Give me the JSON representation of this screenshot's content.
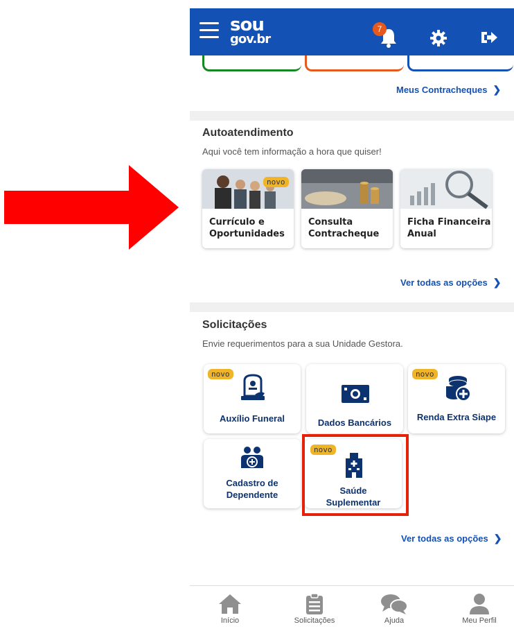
{
  "header": {
    "logo_top": "sou",
    "logo_bottom": "gov.br",
    "notification_count": "7"
  },
  "payslip_link": "Meus Contracheques",
  "autoatendimento": {
    "title": "Autoatendimento",
    "subtitle": "Aqui você tem informação a hora que quiser!",
    "cards": [
      {
        "line1": "Currículo e",
        "line2": "Oportunidades",
        "badge": "novo"
      },
      {
        "line1": "Consulta",
        "line2": "Contracheque"
      },
      {
        "line1": "Ficha Financeira",
        "line2": "Anual"
      }
    ],
    "see_all": "Ver todas as opções"
  },
  "solicitacoes": {
    "title": "Solicitações",
    "subtitle": "Envie requerimentos para a sua Unidade Gestora.",
    "cards": [
      {
        "line1": "Auxílio Funeral",
        "badge": "novo"
      },
      {
        "line1": "Dados Bancários"
      },
      {
        "line1": "Renda Extra Siape",
        "badge": "novo"
      },
      {
        "line1": "Cadastro de",
        "line2": "Dependente"
      },
      {
        "line1": "Saúde",
        "line2": "Suplementar",
        "badge": "novo"
      }
    ],
    "see_all": "Ver todas as opções"
  },
  "bottom_nav": [
    {
      "label": "Início",
      "icon": "home-icon"
    },
    {
      "label": "Solicitações",
      "icon": "clipboard-icon"
    },
    {
      "label": "Ajuda",
      "icon": "chat-icon"
    },
    {
      "label": "Meu Perfil",
      "icon": "user-icon"
    }
  ],
  "colors": {
    "brand_blue": "#1351b4",
    "highlight_red": "#e52207",
    "badge_yellow": "#f0b429",
    "notification_orange": "#e55a1c"
  }
}
